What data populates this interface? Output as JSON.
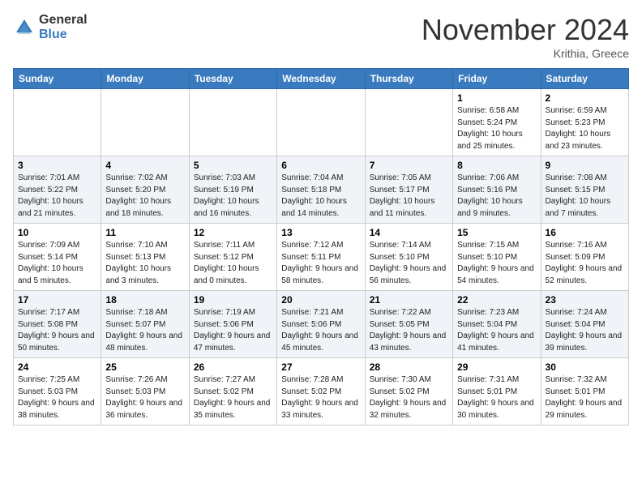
{
  "header": {
    "logo_general": "General",
    "logo_blue": "Blue",
    "month_title": "November 2024",
    "location": "Krithia, Greece"
  },
  "weekdays": [
    "Sunday",
    "Monday",
    "Tuesday",
    "Wednesday",
    "Thursday",
    "Friday",
    "Saturday"
  ],
  "weeks": [
    [
      {
        "day": "",
        "info": ""
      },
      {
        "day": "",
        "info": ""
      },
      {
        "day": "",
        "info": ""
      },
      {
        "day": "",
        "info": ""
      },
      {
        "day": "",
        "info": ""
      },
      {
        "day": "1",
        "info": "Sunrise: 6:58 AM\nSunset: 5:24 PM\nDaylight: 10 hours and 25 minutes."
      },
      {
        "day": "2",
        "info": "Sunrise: 6:59 AM\nSunset: 5:23 PM\nDaylight: 10 hours and 23 minutes."
      }
    ],
    [
      {
        "day": "3",
        "info": "Sunrise: 7:01 AM\nSunset: 5:22 PM\nDaylight: 10 hours and 21 minutes."
      },
      {
        "day": "4",
        "info": "Sunrise: 7:02 AM\nSunset: 5:20 PM\nDaylight: 10 hours and 18 minutes."
      },
      {
        "day": "5",
        "info": "Sunrise: 7:03 AM\nSunset: 5:19 PM\nDaylight: 10 hours and 16 minutes."
      },
      {
        "day": "6",
        "info": "Sunrise: 7:04 AM\nSunset: 5:18 PM\nDaylight: 10 hours and 14 minutes."
      },
      {
        "day": "7",
        "info": "Sunrise: 7:05 AM\nSunset: 5:17 PM\nDaylight: 10 hours and 11 minutes."
      },
      {
        "day": "8",
        "info": "Sunrise: 7:06 AM\nSunset: 5:16 PM\nDaylight: 10 hours and 9 minutes."
      },
      {
        "day": "9",
        "info": "Sunrise: 7:08 AM\nSunset: 5:15 PM\nDaylight: 10 hours and 7 minutes."
      }
    ],
    [
      {
        "day": "10",
        "info": "Sunrise: 7:09 AM\nSunset: 5:14 PM\nDaylight: 10 hours and 5 minutes."
      },
      {
        "day": "11",
        "info": "Sunrise: 7:10 AM\nSunset: 5:13 PM\nDaylight: 10 hours and 3 minutes."
      },
      {
        "day": "12",
        "info": "Sunrise: 7:11 AM\nSunset: 5:12 PM\nDaylight: 10 hours and 0 minutes."
      },
      {
        "day": "13",
        "info": "Sunrise: 7:12 AM\nSunset: 5:11 PM\nDaylight: 9 hours and 58 minutes."
      },
      {
        "day": "14",
        "info": "Sunrise: 7:14 AM\nSunset: 5:10 PM\nDaylight: 9 hours and 56 minutes."
      },
      {
        "day": "15",
        "info": "Sunrise: 7:15 AM\nSunset: 5:10 PM\nDaylight: 9 hours and 54 minutes."
      },
      {
        "day": "16",
        "info": "Sunrise: 7:16 AM\nSunset: 5:09 PM\nDaylight: 9 hours and 52 minutes."
      }
    ],
    [
      {
        "day": "17",
        "info": "Sunrise: 7:17 AM\nSunset: 5:08 PM\nDaylight: 9 hours and 50 minutes."
      },
      {
        "day": "18",
        "info": "Sunrise: 7:18 AM\nSunset: 5:07 PM\nDaylight: 9 hours and 48 minutes."
      },
      {
        "day": "19",
        "info": "Sunrise: 7:19 AM\nSunset: 5:06 PM\nDaylight: 9 hours and 47 minutes."
      },
      {
        "day": "20",
        "info": "Sunrise: 7:21 AM\nSunset: 5:06 PM\nDaylight: 9 hours and 45 minutes."
      },
      {
        "day": "21",
        "info": "Sunrise: 7:22 AM\nSunset: 5:05 PM\nDaylight: 9 hours and 43 minutes."
      },
      {
        "day": "22",
        "info": "Sunrise: 7:23 AM\nSunset: 5:04 PM\nDaylight: 9 hours and 41 minutes."
      },
      {
        "day": "23",
        "info": "Sunrise: 7:24 AM\nSunset: 5:04 PM\nDaylight: 9 hours and 39 minutes."
      }
    ],
    [
      {
        "day": "24",
        "info": "Sunrise: 7:25 AM\nSunset: 5:03 PM\nDaylight: 9 hours and 38 minutes."
      },
      {
        "day": "25",
        "info": "Sunrise: 7:26 AM\nSunset: 5:03 PM\nDaylight: 9 hours and 36 minutes."
      },
      {
        "day": "26",
        "info": "Sunrise: 7:27 AM\nSunset: 5:02 PM\nDaylight: 9 hours and 35 minutes."
      },
      {
        "day": "27",
        "info": "Sunrise: 7:28 AM\nSunset: 5:02 PM\nDaylight: 9 hours and 33 minutes."
      },
      {
        "day": "28",
        "info": "Sunrise: 7:30 AM\nSunset: 5:02 PM\nDaylight: 9 hours and 32 minutes."
      },
      {
        "day": "29",
        "info": "Sunrise: 7:31 AM\nSunset: 5:01 PM\nDaylight: 9 hours and 30 minutes."
      },
      {
        "day": "30",
        "info": "Sunrise: 7:32 AM\nSunset: 5:01 PM\nDaylight: 9 hours and 29 minutes."
      }
    ]
  ]
}
